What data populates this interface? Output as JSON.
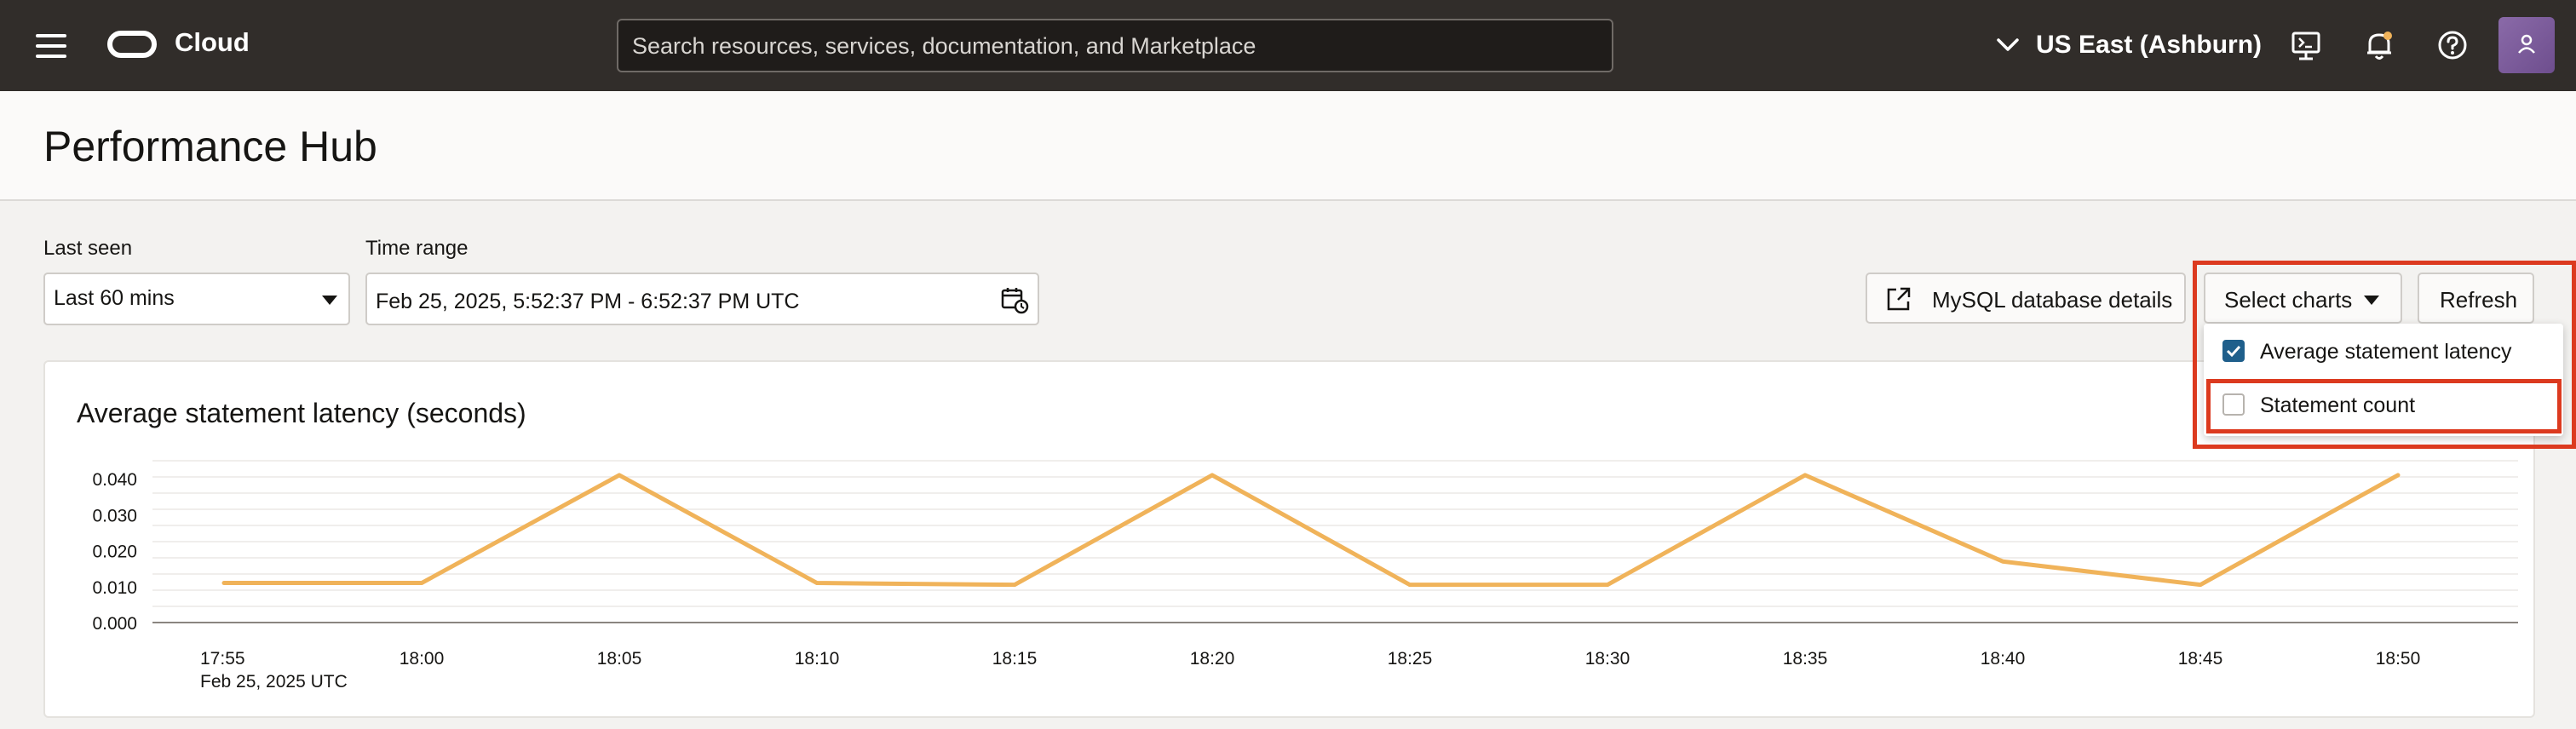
{
  "topbar": {
    "brand": "Cloud",
    "search_placeholder": "Search resources, services, documentation, and Marketplace",
    "region": "US East (Ashburn)"
  },
  "page": {
    "title": "Performance Hub"
  },
  "filters": {
    "last_seen_label": "Last seen",
    "last_seen_value": "Last 60 mins",
    "time_range_label": "Time range",
    "time_range_value": "Feb 25, 2025, 5:52:37 PM - 6:52:37 PM UTC"
  },
  "actions": {
    "db_details": "MySQL database details",
    "select_charts": "Select charts",
    "refresh": "Refresh"
  },
  "select_charts_menu": [
    {
      "label": "Average statement latency",
      "checked": true
    },
    {
      "label": "Statement count",
      "checked": false
    }
  ],
  "colors": {
    "line": "#f0b35a",
    "checkbox": "#1f5f8b",
    "highlight": "#dc3a1f"
  },
  "chart_data": {
    "type": "line",
    "title": "Average statement latency (seconds)",
    "x": [
      "17:55",
      "18:00",
      "18:05",
      "18:10",
      "18:15",
      "18:20",
      "18:25",
      "18:30",
      "18:35",
      "18:40",
      "18:45",
      "18:50"
    ],
    "x_date_label": "Feb 25, 2025 UTC",
    "y_ticks": [
      "0.040",
      "0.030",
      "0.020",
      "0.010",
      "0.000"
    ],
    "ylim": [
      0,
      0.045
    ],
    "series": [
      {
        "values": [
          0.011,
          0.011,
          0.041,
          0.011,
          0.0105,
          0.041,
          0.0105,
          0.0105,
          0.041,
          0.017,
          0.0105,
          0.041
        ]
      }
    ],
    "grid": true
  }
}
